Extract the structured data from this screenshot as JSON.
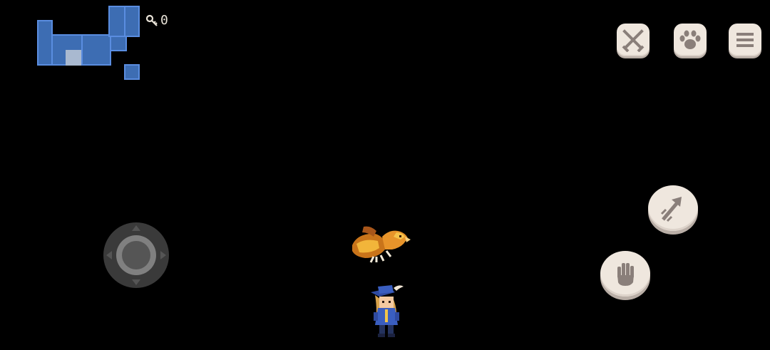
{
  "hud": {
    "key_count": "0",
    "key_icon": "key-icon",
    "minimap_icon": "minimap"
  },
  "buttons": {
    "skills": "crossed-swords-icon",
    "pet": "paw-icon",
    "menu": "hamburger-menu-icon",
    "dash": "dash-arrow-icon",
    "interact": "hand-icon"
  },
  "controls": {
    "joystick": "virtual-joystick"
  },
  "entities": {
    "companion": "eagle-sprite",
    "player": "witch-sprite"
  },
  "colors": {
    "background": "#000000",
    "minimap_room": "#3d6db3",
    "minimap_border": "#5a8de0",
    "minimap_current": "#a9b9d0",
    "button_face": "#efe7de",
    "icon_color": "#8a7f7a"
  }
}
